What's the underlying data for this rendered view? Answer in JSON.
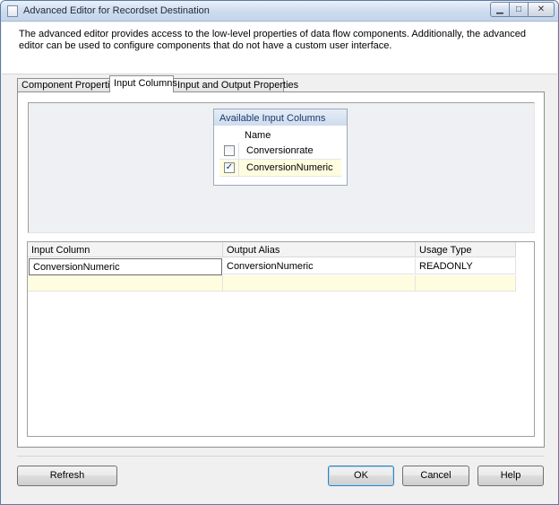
{
  "window": {
    "title": "Advanced Editor for Recordset Destination",
    "min_glyph": "▁",
    "max_glyph": "□",
    "close_glyph": "✕"
  },
  "header": {
    "description": "The advanced editor provides access to the low-level properties of data flow components. Additionally, the advanced editor can be used to configure components that do not have a custom user interface."
  },
  "tabs": [
    {
      "label": "Component Properties",
      "active": false
    },
    {
      "label": "Input Columns",
      "active": true
    },
    {
      "label": "Input and Output Properties",
      "active": false
    }
  ],
  "available_columns": {
    "title": "Available Input Columns",
    "header": "Name",
    "rows": [
      {
        "name": "Conversionrate",
        "checked": false
      },
      {
        "name": "ConversionNumeric",
        "checked": true
      }
    ]
  },
  "mapping_grid": {
    "headers": [
      "Input Column",
      "Output Alias",
      "Usage Type"
    ],
    "rows": [
      {
        "input_column": "ConversionNumeric",
        "output_alias": "ConversionNumeric",
        "usage_type": "READONLY"
      }
    ]
  },
  "buttons": {
    "refresh": "Refresh",
    "ok": "OK",
    "cancel": "Cancel",
    "help": "Help"
  },
  "glyphs": {
    "check": "✓"
  }
}
